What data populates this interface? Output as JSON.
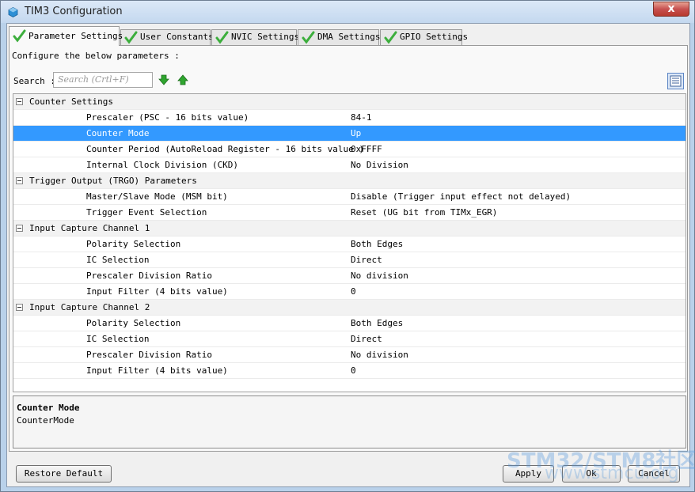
{
  "window": {
    "title": "TIM3 Configuration",
    "close_label": "x"
  },
  "tabs": [
    {
      "label": "Parameter Settings",
      "active": true
    },
    {
      "label": "User Constants",
      "active": false
    },
    {
      "label": "NVIC Settings",
      "active": false
    },
    {
      "label": "DMA Settings",
      "active": false
    },
    {
      "label": "GPIO Settings",
      "active": false
    }
  ],
  "panel": {
    "instruction": "Configure the below parameters :",
    "search_label": "Search :",
    "search_placeholder": "Search (Crtl+F)"
  },
  "tree": {
    "groups": [
      {
        "label": "Counter Settings",
        "params": [
          {
            "name": "Prescaler (PSC - 16 bits value)",
            "value": "84-1"
          },
          {
            "name": "Counter Mode",
            "value": "Up",
            "selected": true
          },
          {
            "name": "Counter Period (AutoReload Register - 16 bits value )",
            "value": "0xFFFF"
          },
          {
            "name": "Internal Clock Division (CKD)",
            "value": "No Division"
          }
        ]
      },
      {
        "label": "Trigger Output (TRGO) Parameters",
        "params": [
          {
            "name": "Master/Slave Mode (MSM bit)",
            "value": "Disable (Trigger input effect not delayed)"
          },
          {
            "name": "Trigger Event Selection",
            "value": "Reset (UG bit from TIMx_EGR)"
          }
        ]
      },
      {
        "label": "Input Capture Channel 1",
        "params": [
          {
            "name": "Polarity Selection",
            "value": "Both Edges"
          },
          {
            "name": "IC Selection",
            "value": "Direct"
          },
          {
            "name": "Prescaler Division Ratio",
            "value": "No division"
          },
          {
            "name": "Input Filter (4 bits value)",
            "value": "0"
          }
        ]
      },
      {
        "label": "Input Capture Channel 2",
        "params": [
          {
            "name": "Polarity Selection",
            "value": "Both Edges"
          },
          {
            "name": "IC Selection",
            "value": "Direct"
          },
          {
            "name": "Prescaler Division Ratio",
            "value": "No division"
          },
          {
            "name": "Input Filter (4 bits value)",
            "value": "0"
          }
        ]
      }
    ]
  },
  "description": {
    "title": "Counter Mode",
    "text": "CounterMode"
  },
  "buttons": {
    "restore_default": "Restore Default",
    "apply": "Apply",
    "ok": "Ok",
    "cancel": "Cancel"
  },
  "watermark": {
    "main": "STM32/STM8社区",
    "sub": "www.stmcu.org"
  },
  "colors": {
    "selection": "#3399ff",
    "check_green": "#3cae3c",
    "arrow_green": "#2fa52f"
  },
  "icons": {
    "tab_check": "check-icon",
    "search_down": "arrow-down-icon",
    "search_up": "arrow-up-icon",
    "view_toggle": "list-view-icon",
    "app": "cube-icon"
  }
}
